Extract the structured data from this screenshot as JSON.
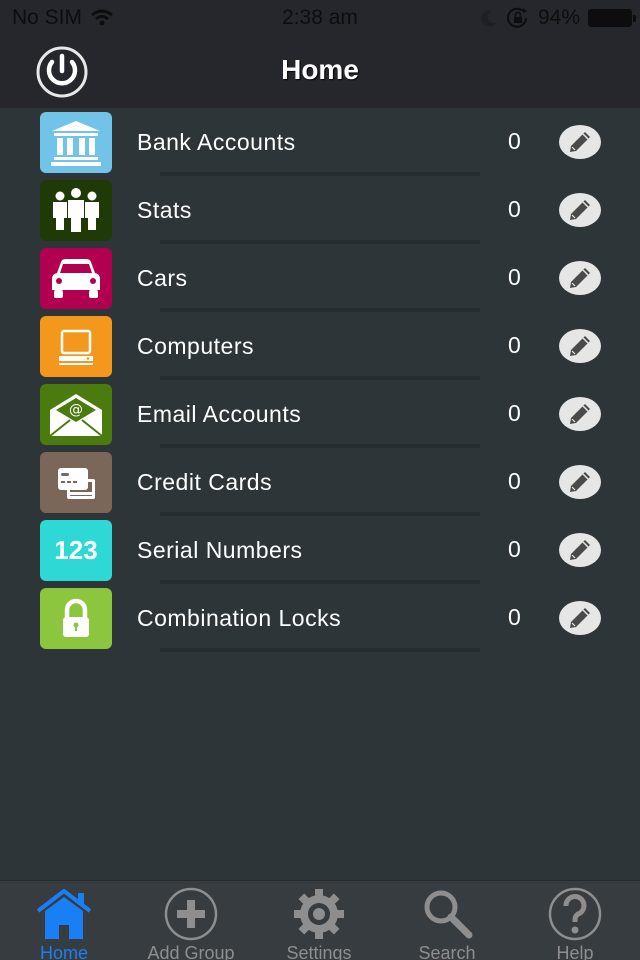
{
  "status_bar": {
    "carrier": "No SIM",
    "time": "2:38 am",
    "battery_percent": "94%",
    "icons": [
      "wifi-icon",
      "moon-icon",
      "rotation-lock-icon",
      "battery-icon"
    ]
  },
  "nav": {
    "title": "Home",
    "left_button_icon": "power-icon"
  },
  "groups": [
    {
      "label": "Bank Accounts",
      "count": "0",
      "icon": "bank-icon",
      "color": "#72c3e8"
    },
    {
      "label": "Stats",
      "count": "0",
      "icon": "people-icon",
      "color": "#1f3a06"
    },
    {
      "label": "Cars",
      "count": "0",
      "icon": "car-icon",
      "color": "#b0004f"
    },
    {
      "label": "Computers",
      "count": "0",
      "icon": "computer-icon",
      "color": "#f3981c"
    },
    {
      "label": "Email Accounts",
      "count": "0",
      "icon": "email-icon",
      "color": "#4b7b0e"
    },
    {
      "label": "Credit Cards",
      "count": "0",
      "icon": "credit-card-icon",
      "color": "#7a675a"
    },
    {
      "label": "Serial Numbers",
      "count": "0",
      "icon": "serial-number-icon",
      "color": "#2ed9d5",
      "icon_text": "123"
    },
    {
      "label": "Combination Locks",
      "count": "0",
      "icon": "lock-icon",
      "color": "#8cc63f"
    }
  ],
  "tabs": [
    {
      "label": "Home",
      "icon": "home-icon",
      "active": true
    },
    {
      "label": "Add Group",
      "icon": "add-icon",
      "active": false
    },
    {
      "label": "Settings",
      "icon": "gear-icon",
      "active": false
    },
    {
      "label": "Search",
      "icon": "search-icon",
      "active": false
    },
    {
      "label": "Help",
      "icon": "help-icon",
      "active": false
    }
  ],
  "colors": {
    "accent": "#1a7ff5",
    "background": "#2e3539",
    "bar": "#26272c",
    "tabbar": "#373c40"
  }
}
